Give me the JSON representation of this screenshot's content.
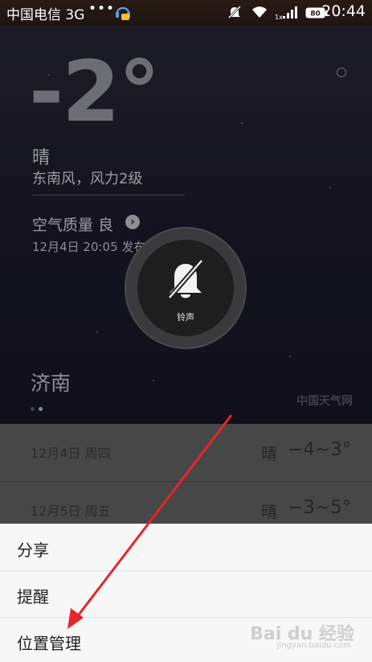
{
  "status_bar": {
    "carrier": "中国电信 3G",
    "dots": "•••",
    "battery": "80",
    "network_badge": "1x",
    "clock": "20:44"
  },
  "weather": {
    "temperature": "-2°",
    "condition": "晴",
    "wind": "东南风，风力2级",
    "air_quality": "空气质量 良",
    "published": "12月4日 20:05 发布",
    "city": "济南",
    "source": "中国天气网",
    "page_count": 2,
    "active_page": 2
  },
  "forecast": [
    {
      "date": "12月4日 周四",
      "condition": "晴",
      "range": "−4~3°"
    },
    {
      "date": "12月5日 周五",
      "condition": "晴",
      "range": "−3~5°"
    }
  ],
  "ringer": {
    "label": "铃声",
    "icon": "bell-muted-icon"
  },
  "menu": {
    "items": [
      {
        "label": "分享"
      },
      {
        "label": "提醒"
      },
      {
        "label": "位置管理"
      }
    ]
  },
  "annotation": {
    "arrow_color": "#e8252a"
  },
  "watermark": {
    "text": "Bai du 经验",
    "sub": "jingyan.baidu.com"
  }
}
